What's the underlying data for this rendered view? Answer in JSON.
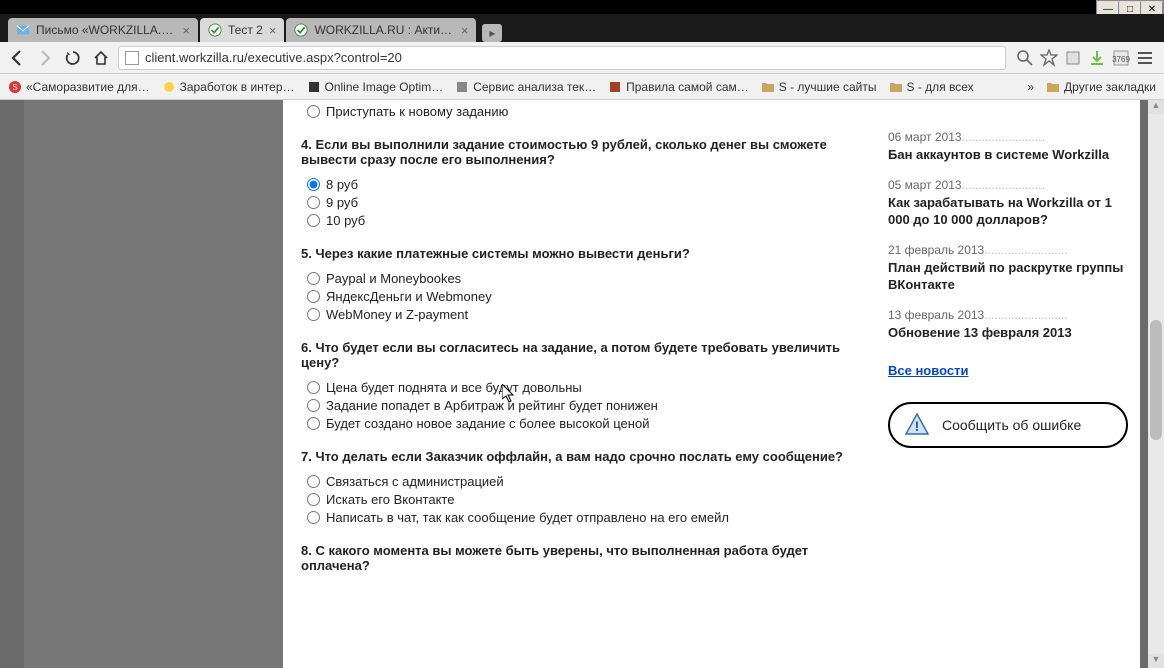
{
  "window_controls": {
    "min": "—",
    "max": "□",
    "close": "✕"
  },
  "tabs": [
    {
      "title": "Письмо «WORKZILLA.RU",
      "active": false
    },
    {
      "title": "Тест 2",
      "active": true
    },
    {
      "title": "WORKZILLA.RU : Активац...",
      "active": false
    }
  ],
  "url": "client.workzilla.ru/executive.aspx?control=20",
  "toolbar_badge": "3769",
  "bookmarks": [
    "«Саморазвитие для…",
    "Заработок в интер…",
    "Online Image Optim…",
    "Сервис анализа тек…",
    "Правила самой сам…",
    "S - лучшие сайты",
    "S - для всех",
    "Другие закладки"
  ],
  "q3_tail_option": "Приступать к новому заданию",
  "q4": {
    "text": "4. Если вы выполнили задание стоимостью 9 рублей, сколько денег вы сможете вывести сразу после его выполнения?",
    "options": [
      "8 руб",
      "9 руб",
      "10 руб"
    ],
    "selected": 0
  },
  "q5": {
    "text": "5. Через какие платежные системы можно вывести деньги?",
    "options": [
      "Paypal и Moneybookes",
      "ЯндексДеньги и Webmoney",
      "WebMoney и Z-payment"
    ]
  },
  "q6": {
    "text": "6. Что будет если вы согласитесь на задание, а потом будете требовать увеличить цену?",
    "options": [
      "Цена будет поднята и все будут довольны",
      "Задание попадет в Арбитраж и рейтинг будет понижен",
      "Будет создано новое задание с более высокой ценой"
    ]
  },
  "q7": {
    "text": "7. Что делать если Заказчик оффлайн, а вам надо срочно послать ему сообщение?",
    "options": [
      "Связаться с администрацией",
      "Искать его Вконтакте",
      "Написать в чат, так как сообщение будет отправлено на его емейл"
    ]
  },
  "q8": {
    "text": "8. С какого момента вы можете быть уверены, что выполненная работа будет оплачена?"
  },
  "news": [
    {
      "date": "06 март 2013",
      "title": "Бан аккаунтов в системе Workzilla"
    },
    {
      "date": "05 март 2013",
      "title": "Как зарабатывать на Workzilla от 1 000 до 10 000 долларов?"
    },
    {
      "date": "21 февраль 2013",
      "title": "План действий по раскрутке группы ВКонтакте"
    },
    {
      "date": "13 февраль 2013",
      "title": "Обновение 13 февраля 2013"
    }
  ],
  "all_news": "Все новости",
  "report_error": "Сообщить об ошибке"
}
